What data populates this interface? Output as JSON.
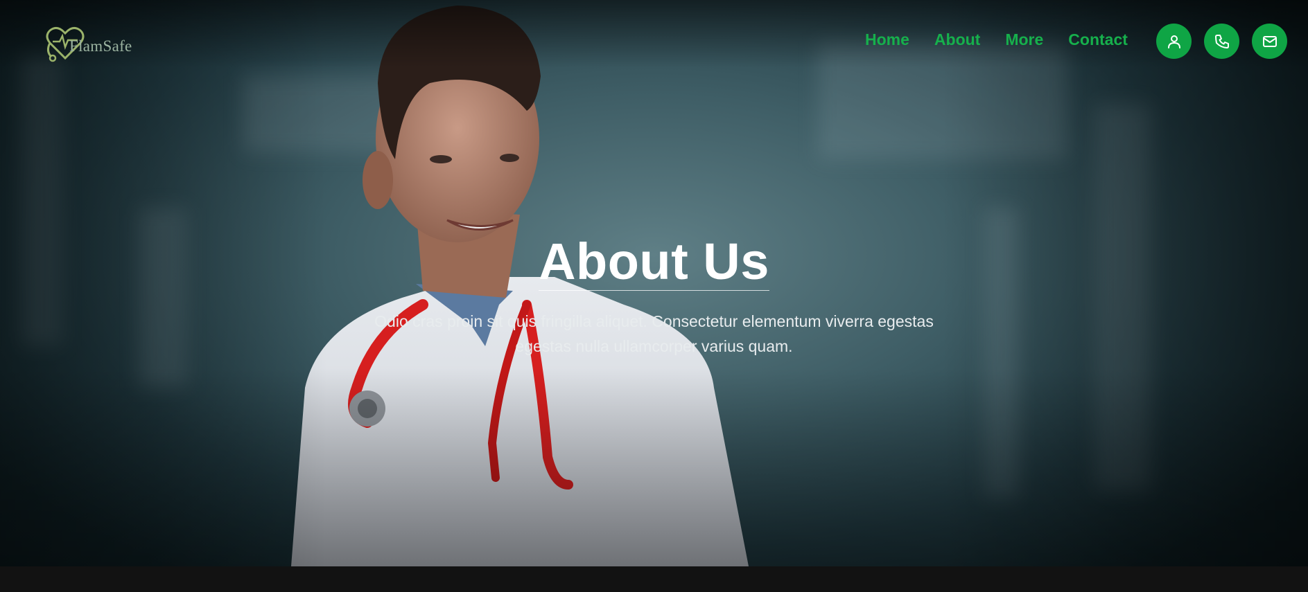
{
  "brand": {
    "name": "FlamSafe",
    "accent_color": "#0fa545"
  },
  "nav": {
    "links": [
      {
        "label": "Home"
      },
      {
        "label": "About"
      },
      {
        "label": "More"
      },
      {
        "label": "Contact"
      }
    ],
    "icon_buttons": [
      {
        "icon": "user-icon"
      },
      {
        "icon": "phone-icon"
      },
      {
        "icon": "mail-icon"
      }
    ]
  },
  "hero": {
    "title": "About Us",
    "description": "Odio cras proin sit quis fringilla aliquet. Consectetur elementum viverra egestas egestas nulla ullamcorper varius quam."
  }
}
